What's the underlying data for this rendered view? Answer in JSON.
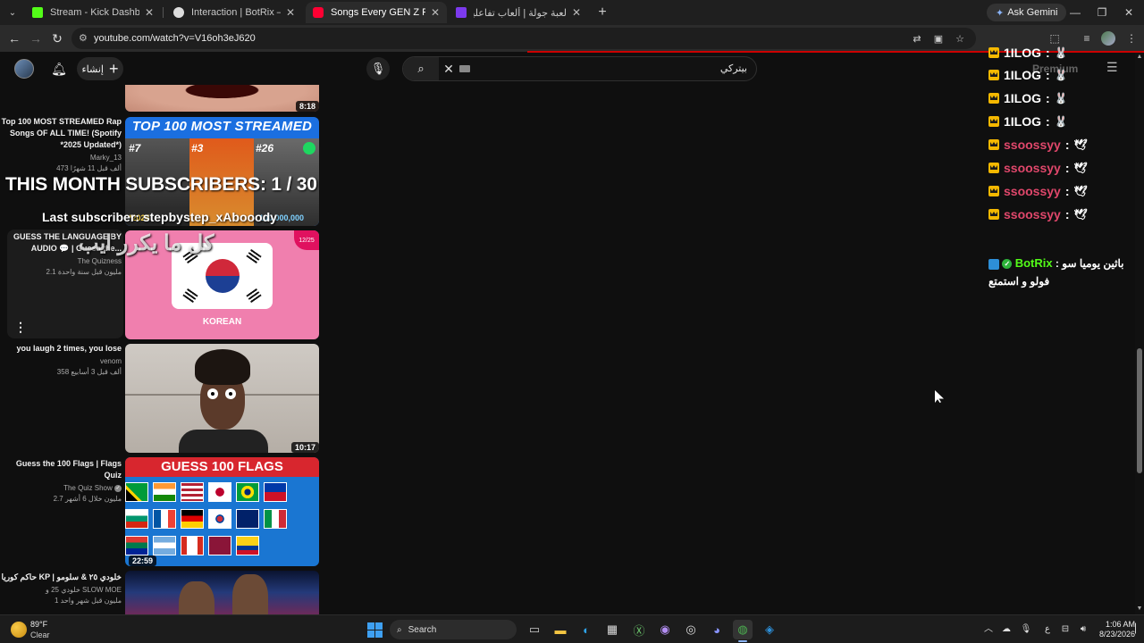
{
  "browser": {
    "tabs": [
      {
        "title": "Stream - Kick Dashboard",
        "favicon_color": "#53fc18",
        "active": false
      },
      {
        "title": "Interaction | BotRix — Cloud Str",
        "favicon_color": "#dddddd",
        "active": false
      },
      {
        "title": "Songs Every GEN Z Remember",
        "favicon_color": "#ff0033",
        "active": true
      },
      {
        "title": "لعبة جولة | ألعاب تفاعلية للبث الـ",
        "favicon_color": "#7c3aed",
        "active": false
      }
    ],
    "ask_gemini_label": "Ask Gemini",
    "url": "youtube.com/watch?v=V16oh3eJ620"
  },
  "youtube": {
    "create_label": "إنشاء",
    "search_query": "بيتركي",
    "premium_label": "Premium",
    "recommendations": [
      {
        "title": "",
        "channel": "",
        "stats": "",
        "duration": "8:18",
        "thumb": "mouth"
      },
      {
        "title": "Top 100 MOST STREAMED Rap Songs OF ALL TIME! (Spotify *2025 Updated*)",
        "channel": "Marky_13",
        "stats": "473 ألف قبل 11 شهرًا",
        "duration": "",
        "thumb": "top100",
        "thumb_text": {
          "head": "TOP 100 MOST STREAMED",
          "r1": "#7",
          "r2": "#3",
          "r3": "#26",
          "year": "*2025",
          "n3": "100,000,000"
        }
      },
      {
        "title": "GUESS THE LANGUAGE BY AUDIO 💬 | Guess the...",
        "channel": "The Quizness",
        "stats": "2.1 مليون قبل سنة واحدة",
        "duration": "",
        "thumb": "korean",
        "thumb_text": {
          "label": "KOREAN",
          "badge": "12/25"
        }
      },
      {
        "title": "you laugh 2 times, you lose",
        "channel": "venom",
        "stats": "358 ألف قبل 3 أسابيع",
        "duration": "10:17",
        "thumb": "face"
      },
      {
        "title": "Guess the 100 Flags | Flags Quiz",
        "channel": "The Quiz Show",
        "stats": "2.7 مليون خلال 6 أشهر",
        "duration": "22:59",
        "thumb": "flags",
        "thumb_text": {
          "head": "GUESS 100 FLAGS"
        }
      },
      {
        "title": "حاكم كوريا KP | خلودي ٢٥ & سلومو",
        "channel": "خلودي 25 و SLOW MOE",
        "stats": "1 مليون قبل شهر واحد",
        "duration": "",
        "thumb": "concert"
      }
    ]
  },
  "overlay": {
    "subscribers_line": "THIS MONTH SUBSCRIBERS: 1 / 30",
    "last_subscriber": "Last subscriber: stepbystep_xAbooody",
    "arabic_caption": "كل ما يكرر ايب"
  },
  "chat": {
    "messages": [
      {
        "user": "1ILOG",
        "sep": ":",
        "color": "#ffffff",
        "emote": "🐰"
      },
      {
        "user": "1ILOG",
        "sep": ":",
        "color": "#ffffff",
        "emote": "🐰"
      },
      {
        "user": "1ILOG",
        "sep": ":",
        "color": "#ffffff",
        "emote": "🐰"
      },
      {
        "user": "1ILOG",
        "sep": ":",
        "color": "#ffffff",
        "emote": "🐰"
      },
      {
        "user": "ssoossyy",
        "sep": ":",
        "color": "#e0476b",
        "emote": "🕊"
      },
      {
        "user": "ssoossyy",
        "sep": ":",
        "color": "#e0476b",
        "emote": "🕊"
      },
      {
        "user": "ssoossyy",
        "sep": ":",
        "color": "#e0476b",
        "emote": "🕊"
      },
      {
        "user": "ssoossyy",
        "sep": ":",
        "color": "#e0476b",
        "emote": "🕊"
      }
    ],
    "bot": {
      "name": "BotRix",
      "name_color": "#53fc18",
      "text": "باثين يوميا سو : فولو و استمتع"
    }
  },
  "taskbar": {
    "temperature": "89°F",
    "condition": "Clear",
    "search_label": "Search",
    "time": "1:06 AM",
    "date": "8/23/2026"
  }
}
